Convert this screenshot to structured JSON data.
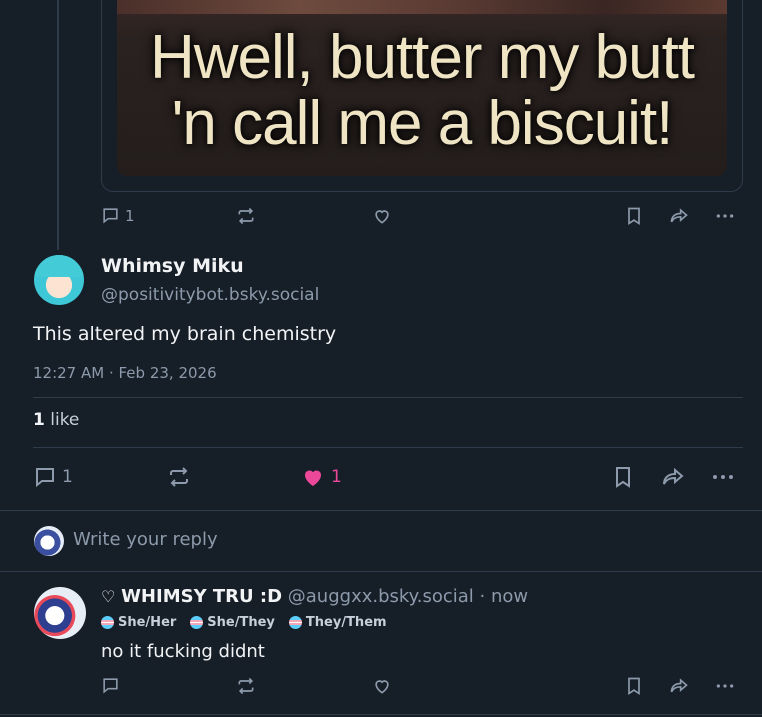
{
  "quoted_post": {
    "meme_caption_line1": "Hwell, butter my butt",
    "meme_caption_line2": "'n call me a biscuit!",
    "reply_count": "1"
  },
  "main_post": {
    "display_name": "Whimsy Miku",
    "handle": "@positivitybot.bsky.social",
    "text": "This altered my brain chemistry",
    "timestamp": "12:27 AM · Feb 23, 2026",
    "like_count_label": "1",
    "like_word": " like",
    "actions": {
      "reply_count": "1",
      "like_count": "1"
    }
  },
  "reply_box": {
    "placeholder": "Write your reply"
  },
  "reply_post": {
    "display_name": "WHIMSY TRU :D",
    "handle": "@auggxx.bsky.social",
    "time": "· now",
    "pronouns": [
      "She/Her",
      "She/They",
      "They/Them"
    ],
    "text": "no it fucking didnt"
  },
  "colors": {
    "background": "#161e27",
    "muted_text": "#8c9aab",
    "liked_pink": "#ec4899",
    "border": "#2e3b4b"
  },
  "icons": [
    "reply-icon",
    "repost-icon",
    "like-icon",
    "bookmark-icon",
    "share-icon",
    "more-icon",
    "heart-badge-icon",
    "pronoun-flag-icon"
  ]
}
